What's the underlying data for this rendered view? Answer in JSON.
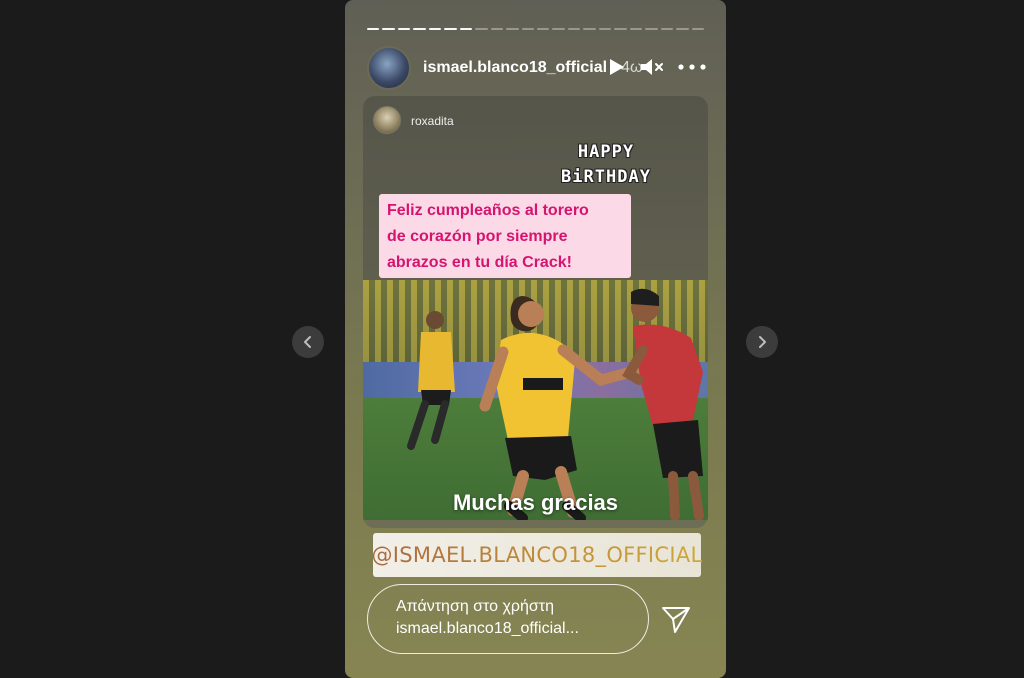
{
  "viewer": {
    "story": {
      "author_username": "ismael.blanco18_official",
      "time_ago": "4ω",
      "progress": {
        "segments_total": 22,
        "segments_viewed": 7
      },
      "icons": {
        "play": "play-icon",
        "mute": "speaker-muted-icon",
        "more": "more-options-icon"
      }
    },
    "shared_post": {
      "username": "roxadita",
      "sticker_text_line1": "HAPPY",
      "sticker_text_line2": "BiRTHDAY",
      "message_lines": [
        "Feliz cumpleaños al torero",
        "de corazón por siempre",
        "abrazos en tu día Crack!"
      ],
      "photo_caption": "Muchas gracias"
    },
    "mention_sticker": "@ISMAEL.BLANCO18_OFFICIAL",
    "reply": {
      "line1": "Απάντηση στο χρήστη",
      "line2": "ismael.blanco18_official..."
    },
    "nav": {
      "prev_icon": "chevron-left-icon",
      "next_icon": "chevron-right-icon",
      "send_icon": "send-icon"
    },
    "colors": {
      "background": "#1b1b1b",
      "message_text": "#d6146f",
      "message_bg": "#fbd9e7"
    }
  }
}
